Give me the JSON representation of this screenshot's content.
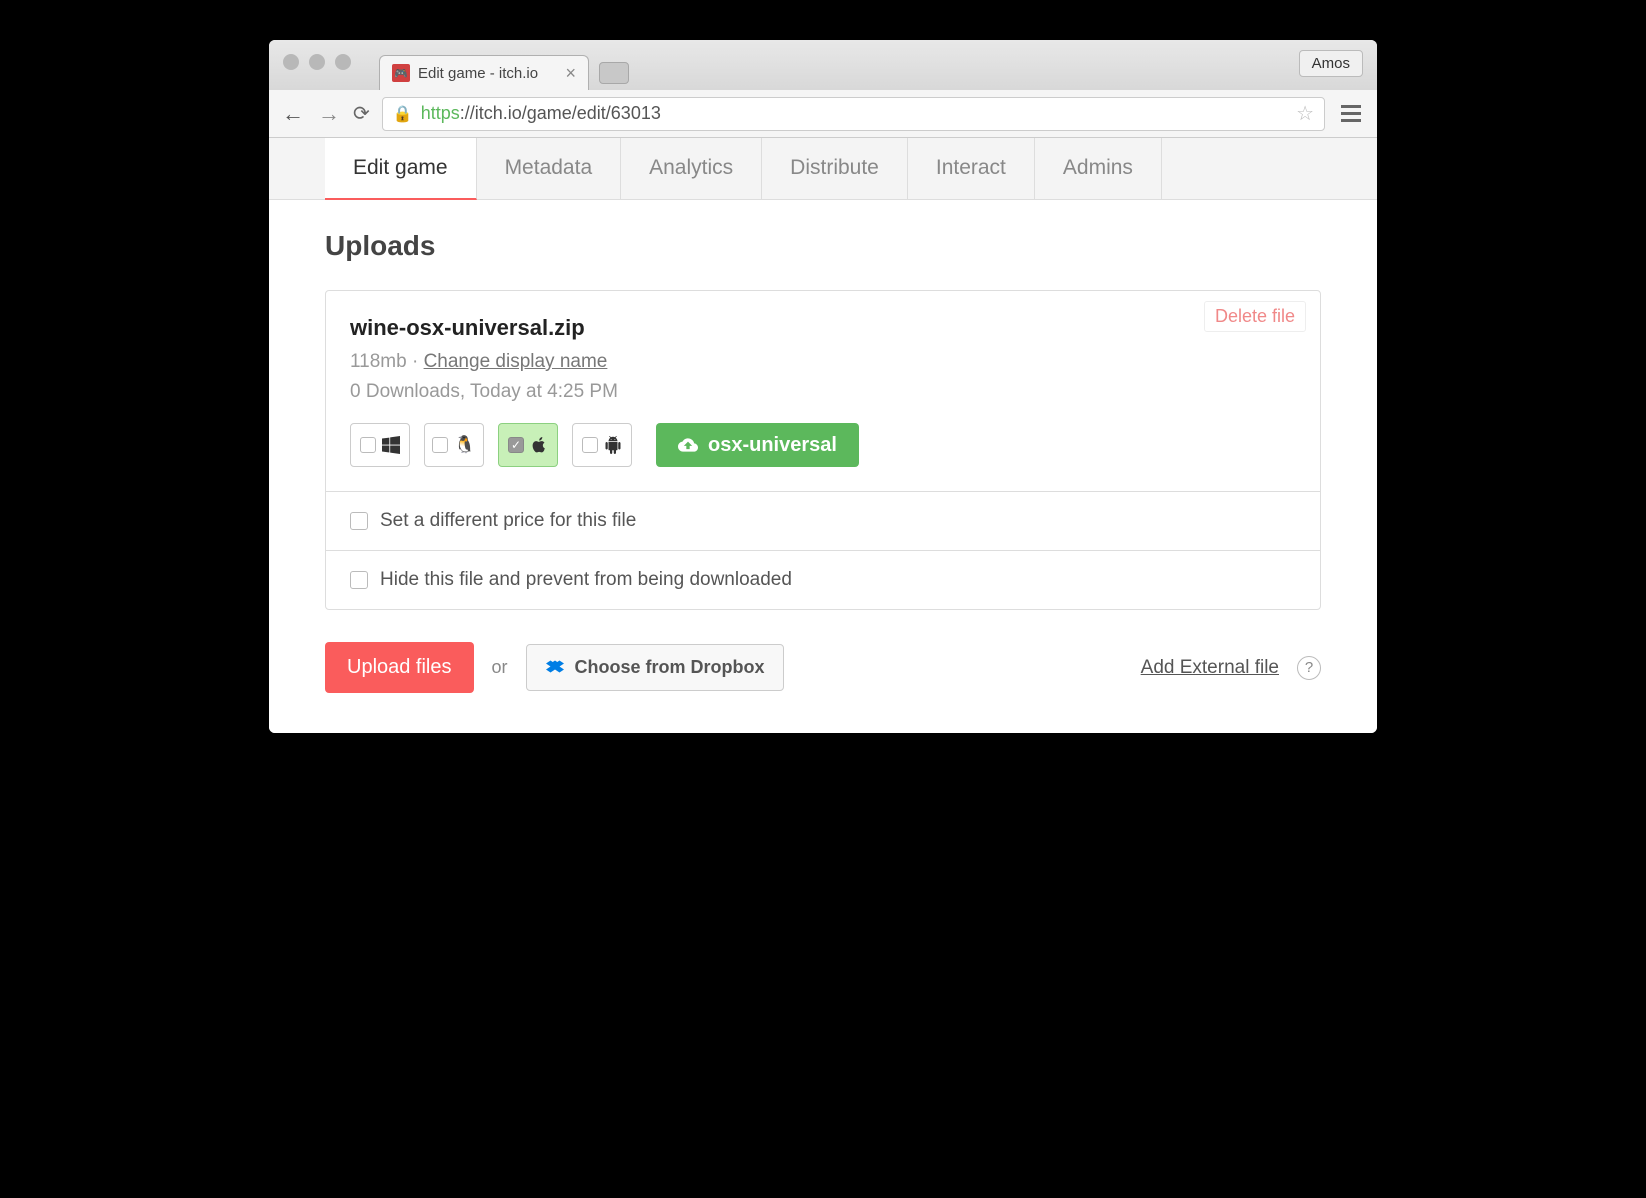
{
  "browser": {
    "tab_title": "Edit game - itch.io",
    "profile_name": "Amos",
    "url_scheme": "https",
    "url_host_path": "://itch.io/game/edit/63013"
  },
  "nav_tabs": [
    {
      "label": "Edit game",
      "active": true
    },
    {
      "label": "Metadata",
      "active": false
    },
    {
      "label": "Analytics",
      "active": false
    },
    {
      "label": "Distribute",
      "active": false
    },
    {
      "label": "Interact",
      "active": false
    },
    {
      "label": "Admins",
      "active": false
    }
  ],
  "section": {
    "title": "Uploads"
  },
  "upload": {
    "filename": "wine-osx-universal.zip",
    "size": "118mb",
    "separator": " · ",
    "change_name_label": "Change display name",
    "download_info": "0 Downloads, Today at 4:25 PM",
    "delete_label": "Delete file",
    "platforms": {
      "windows": {
        "checked": false,
        "icon": "windows"
      },
      "linux": {
        "checked": false,
        "icon": "linux"
      },
      "mac": {
        "checked": true,
        "icon": "apple"
      },
      "android": {
        "checked": false,
        "icon": "android"
      }
    },
    "channel_label": "osx-universal",
    "option_price": "Set a different price for this file",
    "option_hide": "Hide this file and prevent from being downloaded"
  },
  "actions": {
    "upload_label": "Upload files",
    "or_label": "or",
    "dropbox_label": "Choose from Dropbox",
    "external_label": "Add External file",
    "help_label": "?"
  }
}
